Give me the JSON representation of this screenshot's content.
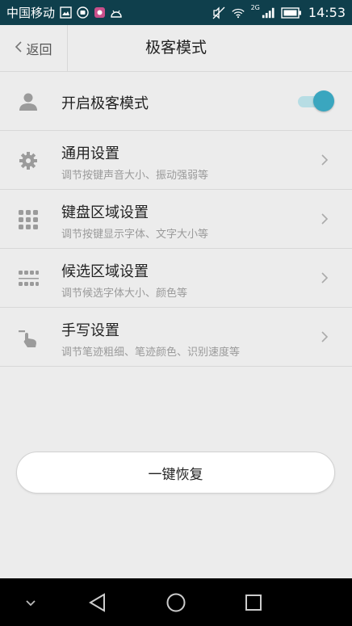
{
  "status_bar": {
    "carrier": "中国移动",
    "network_type": "2G",
    "time": "14:53",
    "icons": [
      "gallery-icon",
      "android-notify-icon",
      "game-icon",
      "android-debug-icon",
      "mute-icon",
      "wifi-icon",
      "signal-icon",
      "battery-icon"
    ]
  },
  "header": {
    "back_label": "返回",
    "title": "极客模式"
  },
  "settings": {
    "geek_mode": {
      "label": "开启极客模式",
      "enabled": true
    },
    "items": [
      {
        "label": "通用设置",
        "desc": "调节按键声音大小、振动强弱等"
      },
      {
        "label": "键盘区域设置",
        "desc": "调节按键显示字体、文字大小等"
      },
      {
        "label": "候选区域设置",
        "desc": "调节候选字体大小、颜色等"
      },
      {
        "label": "手写设置",
        "desc": "调节笔迹粗细、笔迹颜色、识别速度等"
      }
    ]
  },
  "restore_button": {
    "label": "一键恢复"
  },
  "colors": {
    "status_bar_bg": "#0f3f4c",
    "background": "#ececec",
    "accent": "#3aa6bf",
    "icon_gray": "#9b9b9b"
  }
}
